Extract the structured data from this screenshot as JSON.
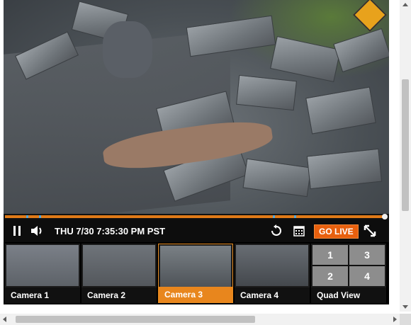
{
  "player": {
    "timestamp": "THU 7/30 7:35:30 PM PST",
    "go_live_label": "GO LIVE",
    "progress_fraction": 0.99,
    "accent_color": "#e8861d"
  },
  "controls": {
    "pause_icon": "pause-icon",
    "volume_icon": "volume-icon",
    "replay_icon": "replay-icon",
    "calendar_icon": "calendar-icon",
    "fullscreen_icon": "fullscreen-icon"
  },
  "cameras": [
    {
      "label": "Camera 1",
      "active": false
    },
    {
      "label": "Camera 2",
      "active": false
    },
    {
      "label": "Camera 3",
      "active": true
    },
    {
      "label": "Camera 4",
      "active": false
    },
    {
      "label": "Quad View",
      "active": false,
      "grid": [
        "1",
        "3",
        "2",
        "4"
      ]
    }
  ]
}
